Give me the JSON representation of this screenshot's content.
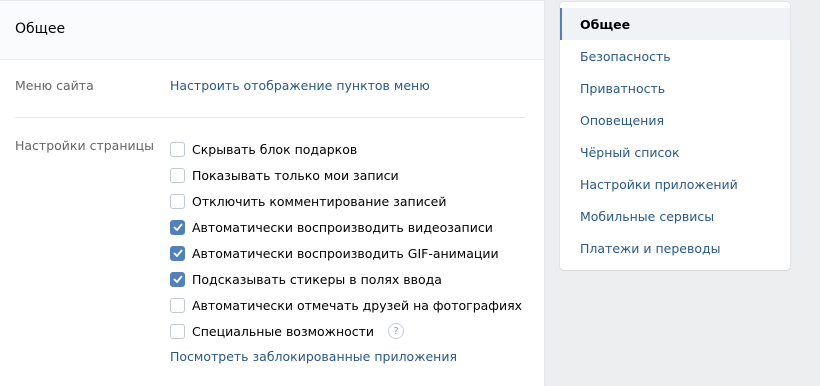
{
  "main": {
    "title": "Общее",
    "menu_row": {
      "label": "Меню сайта",
      "link": "Настроить отображение пунктов меню"
    },
    "page_settings": {
      "label": "Настройки страницы",
      "options": [
        {
          "label": "Скрывать блок подарков",
          "checked": false
        },
        {
          "label": "Показывать только мои записи",
          "checked": false
        },
        {
          "label": "Отключить комментирование записей",
          "checked": false
        },
        {
          "label": "Автоматически воспроизводить видеозаписи",
          "checked": true
        },
        {
          "label": "Автоматически воспроизводить GIF-анимации",
          "checked": true
        },
        {
          "label": "Подсказывать стикеры в полях ввода",
          "checked": true
        },
        {
          "label": "Автоматически отмечать друзей на фотографиях",
          "checked": false
        },
        {
          "label": "Специальные возможности",
          "checked": false,
          "help_icon": "?"
        }
      ],
      "blocked_apps_link": "Посмотреть заблокированные приложения"
    }
  },
  "sidebar": {
    "items": [
      {
        "label": "Общее",
        "active": true
      },
      {
        "label": "Безопасность"
      },
      {
        "label": "Приватность"
      },
      {
        "label": "Оповещения"
      },
      {
        "label": "Чёрный список"
      },
      {
        "label": "Настройки приложений"
      },
      {
        "label": "Мобильные сервисы"
      },
      {
        "label": "Платежи и переводы"
      }
    ]
  },
  "colors": {
    "accent": "#5181b8",
    "link": "#2a5885",
    "background": "#edeef0"
  }
}
